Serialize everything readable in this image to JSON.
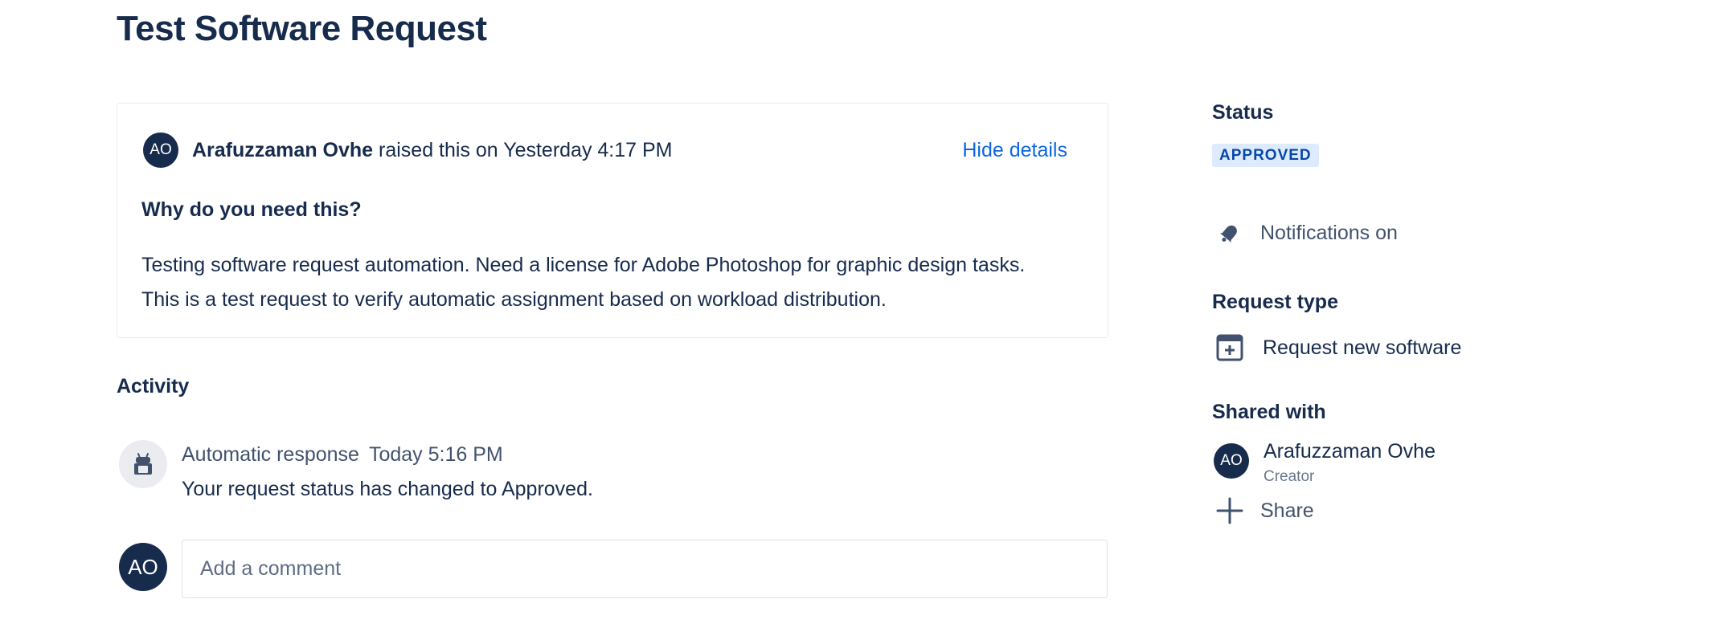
{
  "page": {
    "title": "Test Software Request"
  },
  "request": {
    "reporter_initials": "AO",
    "reporter_name": "Arafuzzaman Ovhe",
    "raised_text": " raised this on Yesterday 4:17 PM",
    "hide_details_label": "Hide details",
    "question": "Why do you need this?",
    "answer_line1": "Testing software request automation. Need a license for Adobe Photoshop for graphic design tasks.",
    "answer_line2": "This is a test request to verify automatic assignment based on workload distribution."
  },
  "activity": {
    "heading": "Activity",
    "items": [
      {
        "author": "Automatic response",
        "time": "Today 5:16 PM",
        "body": "Your request status has changed to Approved.",
        "icon": "robot-icon"
      }
    ],
    "comment": {
      "avatar_initials": "AO",
      "placeholder": "Add a comment"
    }
  },
  "sidebar": {
    "status_label": "Status",
    "status_value": "APPROVED",
    "notifications_label": "Notifications on",
    "notifications_icon": "bell-icon",
    "request_type_label": "Request type",
    "request_type_value": "Request new software",
    "request_type_icon": "request-type-icon",
    "shared_with_label": "Shared with",
    "shared_user": {
      "initials": "AO",
      "name": "Arafuzzaman Ovhe",
      "role": "Creator"
    },
    "share_label": "Share",
    "share_icon": "plus-icon"
  },
  "colors": {
    "text": "#172b4d",
    "subtle_text": "#42526e",
    "link": "#0c66e4",
    "avatar_bg": "#172b4d",
    "badge_bg": "#deebff",
    "badge_text": "#0747a6"
  }
}
